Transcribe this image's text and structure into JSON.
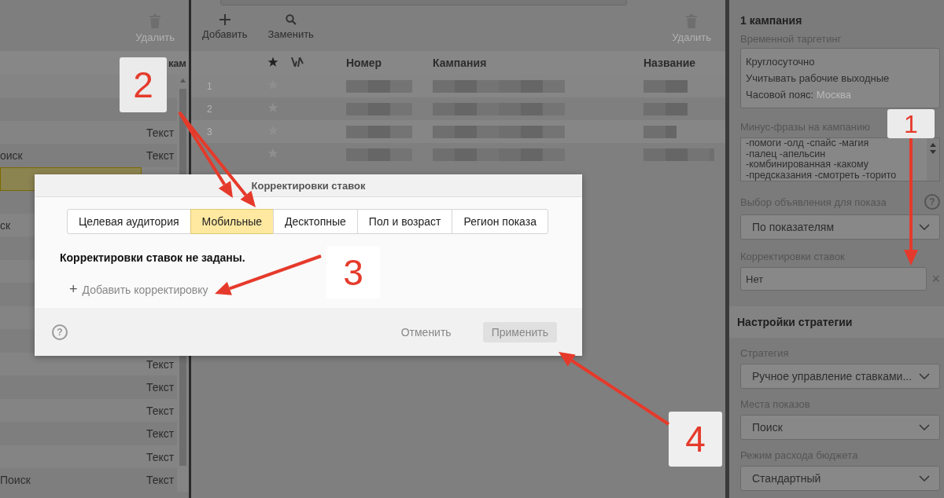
{
  "left_panel": {
    "toolbar": {
      "delete": "Удалить"
    },
    "header": {
      "column_2": "кам"
    },
    "rows": [
      {
        "selected": false
      },
      {
        "selected": false
      },
      {
        "column_2": "Текст",
        "selected": false
      },
      {
        "column_1": "оиск",
        "column_2": "Текст",
        "selected": false
      },
      {
        "selected": true
      },
      {
        "selected": false
      },
      {
        "column_1": "ск",
        "selected": false
      },
      {
        "selected": false
      },
      {
        "selected": false
      },
      {
        "selected": false
      },
      {
        "selected": false
      },
      {
        "selected": false
      },
      {
        "column_2": "Текст",
        "selected": false
      },
      {
        "column_2": "Текст",
        "selected": false
      },
      {
        "column_2": "Текст",
        "selected": false
      },
      {
        "column_2": "Текст",
        "selected": false
      },
      {
        "column_2": "Текст",
        "selected": false
      },
      {
        "column_1": "Поиск",
        "column_2": "Текст",
        "selected": false
      }
    ]
  },
  "main_panel": {
    "toolbar": {
      "add": "Добавить",
      "replace": "Заменить",
      "delete": "Удалить"
    },
    "columns": [
      "Номер",
      "Кампания",
      "Название"
    ],
    "rows": [
      {
        "index": "1",
        "starred": false
      },
      {
        "index": "2",
        "starred": false
      },
      {
        "index": "3",
        "starred": false
      },
      {
        "starred": false
      }
    ]
  },
  "right_panel": {
    "title": "1 кампания",
    "time_targeting": {
      "label": "Временной таргетинг",
      "lines": [
        "Круглосуточно",
        "Учитывать рабочие выходные"
      ],
      "timezone_label": "Часовой пояс:",
      "timezone_value": "Москва"
    },
    "negative_phrases": {
      "label": "Минус-фразы на кампанию",
      "lines": [
        "-помоги -олд -спайс -магия",
        "-палец -апельсин",
        "-комбинированная -какому",
        "-предсказания -смотреть -торито"
      ]
    },
    "ad_choice": {
      "label": "Выбор объявления для показа",
      "help": "?",
      "value": "По показателям"
    },
    "bid_adjustments": {
      "label": "Корректировки ставок",
      "value": "Нет",
      "clear": "×"
    },
    "strategy": {
      "title": "Настройки стратегии",
      "fields": [
        {
          "label": "Стратегия",
          "value": "Ручное управление ставками..."
        },
        {
          "label": "Места показов",
          "value": "Поиск"
        },
        {
          "label": "Режим расхода бюджета",
          "value": "Стандартный"
        }
      ]
    }
  },
  "dialog": {
    "title": "Корректировки ставок",
    "tabs": [
      {
        "label": "Целевая аудитория",
        "selected": false
      },
      {
        "label": "Мобильные",
        "selected": true
      },
      {
        "label": "Десктопные",
        "selected": false
      },
      {
        "label": "Пол и возраст",
        "selected": false
      },
      {
        "label": "Регион показа",
        "selected": false
      }
    ],
    "empty_message": "Корректировки ставок не заданы.",
    "add_icon": "+",
    "add_link": "Добавить корректировку",
    "help": "?",
    "cancel": "Отменить",
    "apply": {
      "label": "Применить",
      "disabled": true
    }
  },
  "annotations": [
    {
      "label": "2"
    },
    {
      "label": "1"
    },
    {
      "label": "3"
    },
    {
      "label": "4"
    }
  ]
}
